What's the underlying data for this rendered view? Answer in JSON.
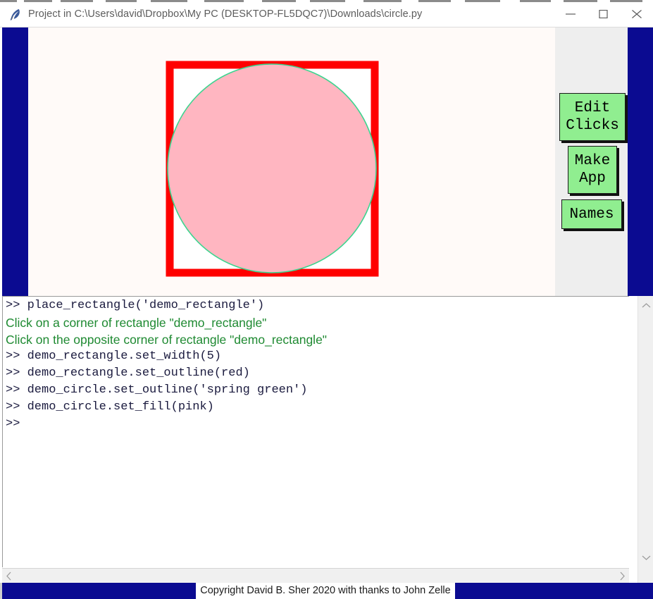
{
  "window": {
    "title": "Project in C:\\Users\\david\\Dropbox\\My PC (DESKTOP-FL5DQC7)\\Downloads\\circle.py",
    "icon": "python-feather-icon",
    "controls": {
      "minimize": "minimize-icon",
      "maximize": "maximize-icon",
      "close": "close-icon"
    }
  },
  "canvas": {
    "background_color": "#fffaf8",
    "shapes": [
      {
        "name": "demo_rectangle",
        "type": "rectangle",
        "outline": "red",
        "outline_hex": "#ff0000",
        "width": 5,
        "fill": "white"
      },
      {
        "name": "demo_circle",
        "type": "circle",
        "outline": "spring green",
        "outline_hex": "#3cd58f",
        "fill": "pink",
        "fill_hex": "#ffb6c1"
      }
    ]
  },
  "buttons": {
    "panel_color": "#eeeeee",
    "button_color": "#90ee90",
    "items": [
      {
        "name": "edit-clicks",
        "label": "Edit\nClicks"
      },
      {
        "name": "make-app",
        "label": "Make\nApp"
      },
      {
        "name": "names",
        "label": "Names"
      }
    ]
  },
  "console": {
    "prompt_color": "#1a1a3e",
    "output_color": "#1f8a32",
    "lines": [
      {
        "kind": "cmd",
        "text": ">> place_rectangle('demo_rectangle')"
      },
      {
        "kind": "out",
        "text": "Click on a corner of rectangle \"demo_rectangle\""
      },
      {
        "kind": "out",
        "text": "Click on the opposite corner of rectangle \"demo_rectangle\""
      },
      {
        "kind": "cmd",
        "text": ">> demo_rectangle.set_width(5)"
      },
      {
        "kind": "cmd",
        "text": ">> demo_rectangle.set_outline(red)"
      },
      {
        "kind": "cmd",
        "text": ">> demo_circle.set_outline('spring green')"
      },
      {
        "kind": "cmd",
        "text": ">> demo_circle.set_fill(pink)"
      },
      {
        "kind": "cmd",
        "text": ">>"
      }
    ]
  },
  "scrollbars": {
    "horizontal": {
      "left_arrow": "chevron-left-icon",
      "right_arrow": "chevron-right-icon"
    },
    "vertical": {
      "up_arrow": "chevron-up-icon",
      "down_arrow": "chevron-down-icon"
    }
  },
  "statusbar": {
    "text": "Copyright David B. Sher 2020 with thanks to John Zelle",
    "background_color": "#0b0b91"
  },
  "background": {
    "navy_band_color": "#0b0b91",
    "palette_swatches": [
      "#ffffff",
      "#ffffff",
      "#cccccc",
      "#cccccc",
      "#e03a3a",
      "#e03a3a",
      "#3aa03a",
      "#3aa03a",
      "#2a6fd6",
      "#2a6fd6",
      "#111111",
      "#111111",
      "#111111",
      "#111111",
      "#7a7a7a",
      "#7a7a7a",
      "#e07a22",
      "#e07a22",
      "#7a3ac0",
      "#7a3ac0",
      "#e03ab4",
      "#e03ab4",
      "#e8e020",
      "#e8e020",
      "#b07a22",
      "#b07a22",
      "#22c0d0",
      "#22c0d0",
      "#9a6ad0",
      "#9a6ad0",
      "#f0a0d0",
      "#f0a0d0",
      "#dddddd",
      "#dddddd"
    ]
  }
}
